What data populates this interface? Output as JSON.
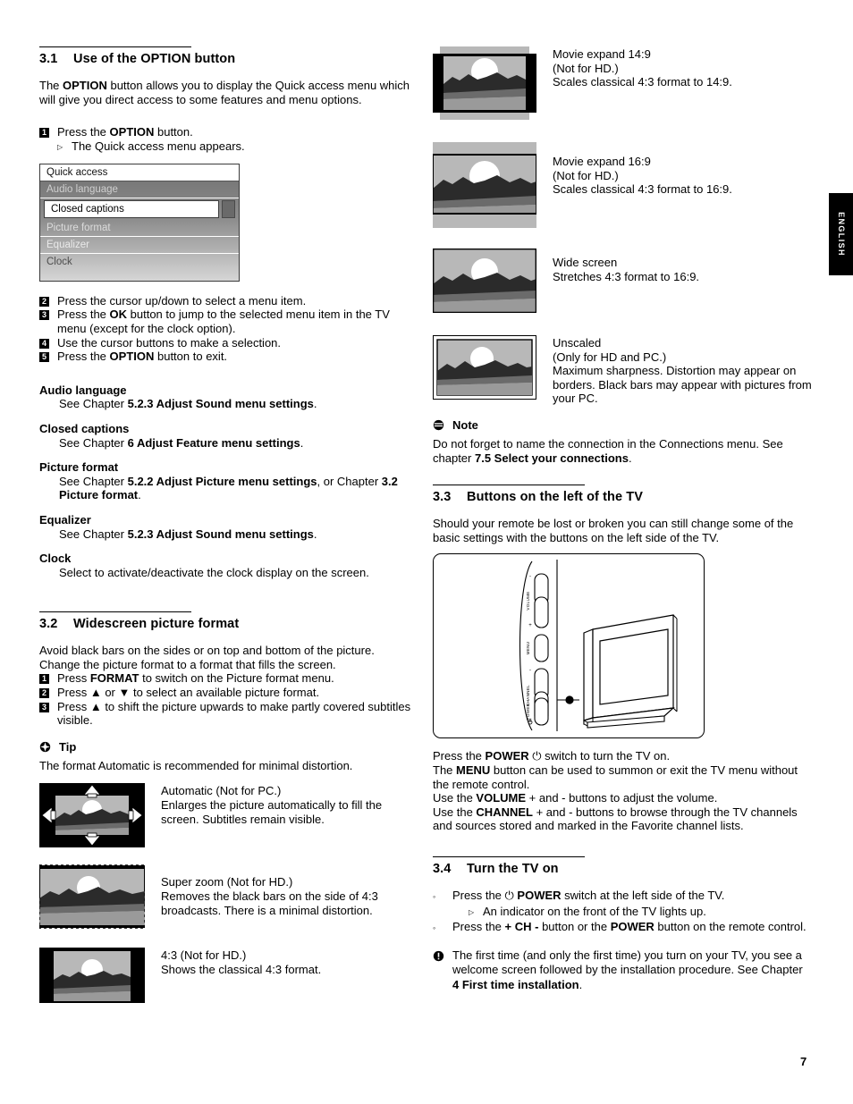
{
  "page": {
    "number": "7",
    "language_tab": "ENGLISH"
  },
  "left": {
    "s31": {
      "num": "3.1",
      "title": "Use of the OPTION button",
      "intro_1": "The ",
      "intro_b1": "OPTION",
      "intro_2": " button allows you to display the Quick access menu which will give you direct access to some features and menu options.",
      "step1_pre": "Press the ",
      "step1_b": "OPTION",
      "step1_post": " button.",
      "step1_sub": "The Quick access menu appears.",
      "quick_access": {
        "title": "Quick access",
        "items": [
          "Audio language",
          "Closed captions",
          "Picture format",
          "Equalizer",
          "Clock"
        ],
        "selected": "Closed captions"
      },
      "step2": "Press the cursor up/down to select a menu item.",
      "step3_pre": "Press the ",
      "step3_b": "OK",
      "step3_post": " button to jump to the selected menu item in the TV menu (except for the clock option).",
      "step4": "Use the cursor buttons to make a selection.",
      "step5_pre": "Press the ",
      "step5_b": "OPTION",
      "step5_post": " button to exit.",
      "defs": [
        {
          "term": "Audio language",
          "pre": "See Chapter ",
          "bold": "5.2.3 Adjust Sound menu settings",
          "post": "."
        },
        {
          "term": "Closed captions",
          "pre": "See Chapter ",
          "bold": "6 Adjust Feature menu settings",
          "post": "."
        },
        {
          "term": "Picture format",
          "pre": "See Chapter ",
          "bold": "5.2.2 Adjust Picture menu settings",
          "mid": ", or Chapter ",
          "bold2": "3.2 Picture format",
          "post": "."
        },
        {
          "term": "Equalizer",
          "pre": "See Chapter ",
          "bold": "5.2.3 Adjust Sound menu settings",
          "post": "."
        },
        {
          "term": "Clock",
          "pre": "Select to activate/deactivate the clock display on the screen.",
          "bold": "",
          "post": ""
        }
      ]
    },
    "s32": {
      "num": "3.2",
      "title": "Widescreen picture format",
      "intro": "Avoid black bars on the sides or on top and bottom of the picture. Change the picture format to a format that fills the screen.",
      "step1_pre": "Press ",
      "step1_b": "FORMAT",
      "step1_post": " to switch on the Picture format menu.",
      "step2": "Press ▲ or ▼ to select an available picture format.",
      "step3": "Press ▲ to shift the picture upwards to make partly covered subtitles visible.",
      "tip_label": "Tip",
      "tip_body": "The format Automatic is recommended for minimal distortion.",
      "formats": [
        {
          "kind": "automatic",
          "title": "Automatic (Not for PC.)",
          "desc": "Enlarges the picture automatically to fill the screen. Subtitles remain visible."
        },
        {
          "kind": "superzoom",
          "title": "Super zoom (Not for HD.)",
          "desc": "Removes the black bars on the side of 4:3 broadcasts. There is a minimal distortion."
        },
        {
          "kind": "fourthree",
          "title": "4:3 (Not for HD.)",
          "desc": "Shows the classical 4:3 format."
        }
      ]
    }
  },
  "right": {
    "formats": [
      {
        "kind": "movie149",
        "line1": "Movie expand 14:9",
        "line2": "(Not for HD.)",
        "line3": "Scales classical 4:3 format to 14:9."
      },
      {
        "kind": "movie169",
        "line1": "Movie expand 16:9",
        "line2": "(Not for HD.)",
        "line3": "Scales classical 4:3 format to 16:9."
      },
      {
        "kind": "widescreen",
        "line1": "Wide screen",
        "line2": "Stretches 4:3 format to 16:9.",
        "line3": ""
      },
      {
        "kind": "unscaled",
        "line1": "Unscaled",
        "line2": "(Only for HD and PC.)",
        "line3": "Maximum sharpness. Distortion may appear on borders. Black bars may appear with pictures from your PC."
      }
    ],
    "note": {
      "label": "Note",
      "pre": "Do not forget to name the connection in the Connections menu. See chapter ",
      "bold": "7.5 Select your connections",
      "post": "."
    },
    "s33": {
      "num": "3.3",
      "title": "Buttons on the left of the TV",
      "intro": "Should your remote be lost or broken you can still change some of the basic settings with the buttons on the left side of the TV.",
      "figure_labels": [
        "VOLUME",
        "MENU",
        "CHANNEL",
        "POWER"
      ],
      "figure_signs": {
        "minus": "-",
        "plus": "+"
      },
      "body": [
        {
          "pre": "Press the ",
          "bold": "POWER",
          "mid": " ⏻ switch to turn the TV on.",
          "post": ""
        },
        {
          "pre": "The ",
          "bold": "MENU",
          "mid": " button can be used to summon or exit the TV menu without the remote control.",
          "post": ""
        },
        {
          "pre": "Use the ",
          "bold": "VOLUME",
          "mid": " + and - buttons to adjust the volume.",
          "post": ""
        },
        {
          "pre": "Use the ",
          "bold": "CHANNEL",
          "mid": " + and - buttons to browse through the TV channels and sources stored and marked in the Favorite channel lists.",
          "post": ""
        }
      ]
    },
    "s34": {
      "num": "3.4",
      "title": "Turn the TV on",
      "b1_pre": "Press the ⏻ ",
      "b1_b": "POWER",
      "b1_post": " switch at the left side of the TV.",
      "b1_sub": "An indicator on the front of the TV lights up.",
      "b2_pre": "Press the ",
      "b2_b1": "+ CH -",
      "b2_mid": " button or the ",
      "b2_b2": "POWER",
      "b2_post": " button on the remote control.",
      "warn_pre": "The first time (and only the first time) you turn on your TV, you see a welcome screen followed by the installation procedure. See Chapter ",
      "warn_bold": "4 First time installation",
      "warn_post": "."
    }
  },
  "colors": {
    "black": "#000000",
    "sky": "#b8b8b8",
    "mountain": "#2b2b2b",
    "midband": "#6b6b6b",
    "foreground": "#9a9a9a",
    "sun": "#ffffff"
  }
}
